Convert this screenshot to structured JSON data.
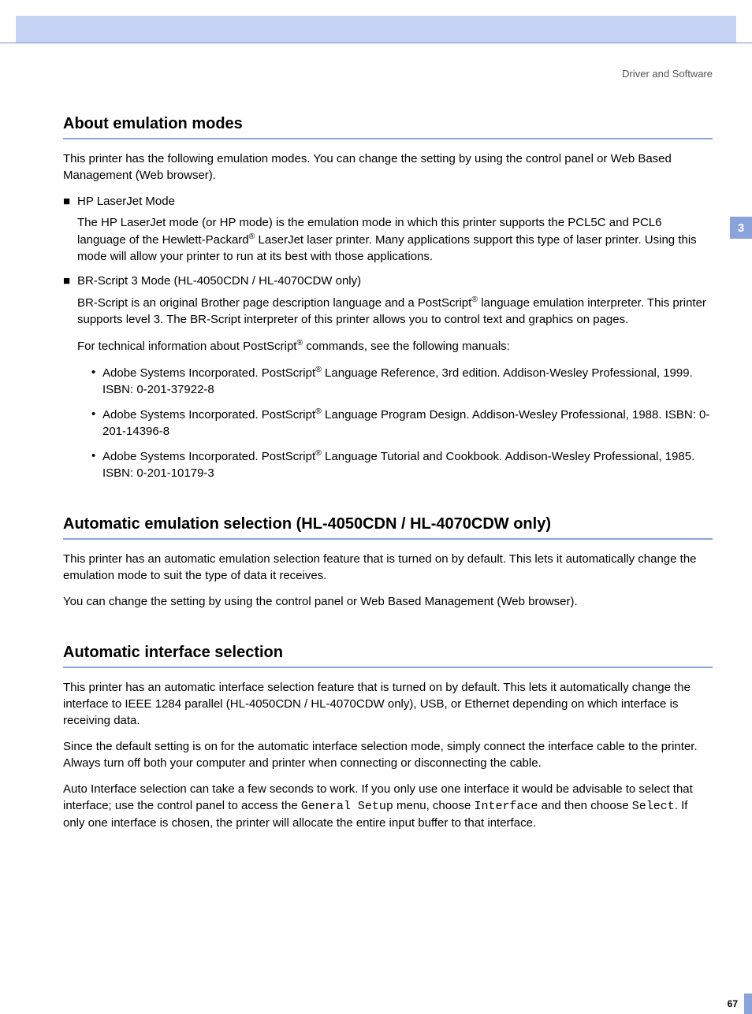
{
  "header": {
    "right": "Driver and Software"
  },
  "tab": "3",
  "page_number": "67",
  "s1": {
    "title": "About emulation modes",
    "intro": "This printer has the following emulation modes. You can change the setting by using the control panel or Web Based Management (Web browser).",
    "hp_title": "HP LaserJet Mode",
    "hp_body_a": "The HP LaserJet mode (or HP mode) is the emulation mode in which this printer supports the PCL5C and PCL6 language of the Hewlett-Packard",
    "hp_body_b": " LaserJet laser printer. Many applications support this type of laser printer. Using this mode will allow your printer to run at its best with those applications.",
    "br_title": "BR-Script 3 Mode (HL-4050CDN / HL-4070CDW only)",
    "br_body_a": "BR-Script is an original Brother page description language and a PostScript",
    "br_body_b": " language emulation interpreter. This printer supports level 3. The BR-Script interpreter of this printer allows you to control text and graphics on pages.",
    "br_tech_a": "For technical information about PostScript",
    "br_tech_b": " commands, see the following manuals:",
    "refs": {
      "r1a": "Adobe Systems Incorporated. PostScript",
      "r1b": " Language Reference, 3rd edition. Addison-Wesley Professional, 1999. ISBN: 0-201-37922-8",
      "r2a": "Adobe Systems Incorporated. PostScript",
      "r2b": " Language Program Design. Addison-Wesley Professional, 1988. ISBN: 0-201-14396-8",
      "r3a": "Adobe Systems Incorporated. PostScript",
      "r3b": " Language Tutorial and Cookbook. Addison-Wesley Professional, 1985. ISBN: 0-201-10179-3"
    }
  },
  "s2": {
    "title": "Automatic emulation selection (HL-4050CDN / HL-4070CDW only)",
    "p1": "This printer has an automatic emulation selection feature that is turned on by default. This lets it automatically change the emulation mode to suit the type of data it receives.",
    "p2": "You can change the setting by using the control panel or Web Based Management (Web browser)."
  },
  "s3": {
    "title": "Automatic interface selection",
    "p1": "This printer has an automatic interface selection feature that is turned on by default. This lets it automatically change the interface to IEEE 1284 parallel (HL-4050CDN / HL-4070CDW only),  USB, or Ethernet depending on which interface is receiving data.",
    "p2": "Since the default setting is on for the automatic interface selection mode, simply connect the interface cable to the printer. Always turn off both your computer and printer when connecting or disconnecting the cable.",
    "p3a": "Auto Interface selection can take a few seconds to work. If you only use one interface it would be advisable to select that interface; use the control panel to access the ",
    "p3_m1": "General Setup",
    "p3b": " menu, choose ",
    "p3_m2": "Interface",
    "p3c": " and then choose ",
    "p3_m3": "Select",
    "p3d": ". If only one interface is chosen, the printer will allocate the entire input buffer to that interface."
  },
  "reg": "®"
}
